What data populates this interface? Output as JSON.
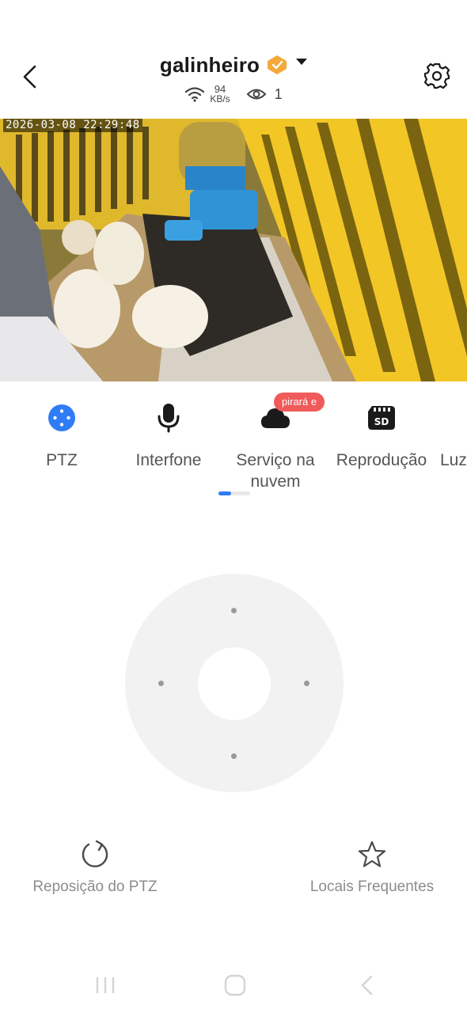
{
  "header": {
    "title": "galinheiro",
    "badge_icon": "verified-badge-icon",
    "speed_value": "94",
    "speed_unit": "KB/s",
    "viewer_count": "1"
  },
  "video": {
    "timestamp": "2026-03-08 22:29:48"
  },
  "tools": [
    {
      "label": "PTZ",
      "icon": "ptz-icon",
      "color": "#2f7cf6"
    },
    {
      "label": "Interfone",
      "icon": "microphone-icon"
    },
    {
      "label": "Serviço na nuvem",
      "icon": "cloud-icon",
      "badge": "pirará e"
    },
    {
      "label": "Reprodução",
      "icon": "sd-card-icon"
    },
    {
      "label": "Luz",
      "icon": "light-icon"
    }
  ],
  "actions": {
    "reset_label": "Reposição do PTZ",
    "favorites_label": "Locais Frequentes"
  },
  "colors": {
    "accent": "#2f7cf6",
    "badge": "#f05a5a",
    "pad": "#f2f2f2"
  }
}
